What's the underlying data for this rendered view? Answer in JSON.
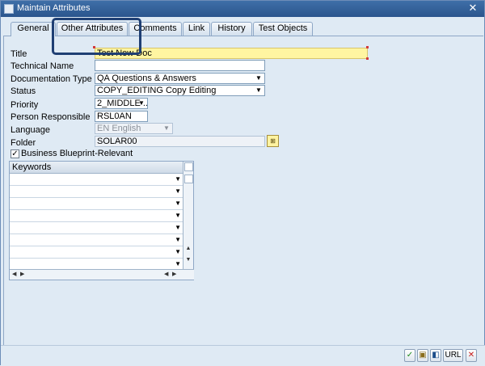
{
  "window": {
    "title": "Maintain Attributes"
  },
  "tabs": [
    {
      "label": "General",
      "active": true
    },
    {
      "label": "Other Attributes",
      "active": false
    },
    {
      "label": "Comments",
      "active": false
    },
    {
      "label": "Link",
      "active": false
    },
    {
      "label": "History",
      "active": false
    },
    {
      "label": "Test Objects",
      "active": false
    }
  ],
  "form": {
    "title": {
      "label": "Title",
      "value": "Test New Doc"
    },
    "technical_name": {
      "label": "Technical Name",
      "value": ""
    },
    "documentation_type": {
      "label": "Documentation Type",
      "value": "QA Questions & Answers"
    },
    "status": {
      "label": "Status",
      "value": "COPY_EDITING Copy Editing"
    },
    "priority": {
      "label": "Priority",
      "value": "2_MIDDLE ..."
    },
    "person_responsible": {
      "label": "Person Responsible",
      "value": "RSL0AN"
    },
    "language": {
      "label": "Language",
      "value": "EN English"
    },
    "folder": {
      "label": "Folder",
      "value": "SOLAR00"
    },
    "business_blueprint": {
      "label": "Business Blueprint-Relevant",
      "checked": true
    }
  },
  "keywords_table": {
    "header": "Keywords",
    "rows": [
      "",
      "",
      "",
      "",
      "",
      "",
      "",
      ""
    ]
  },
  "toolbar": {
    "url_label": "URL"
  },
  "colors": {
    "titlebar": "#2b558d",
    "required_field": "#fff5a1",
    "annotation": "#1f3f73"
  }
}
